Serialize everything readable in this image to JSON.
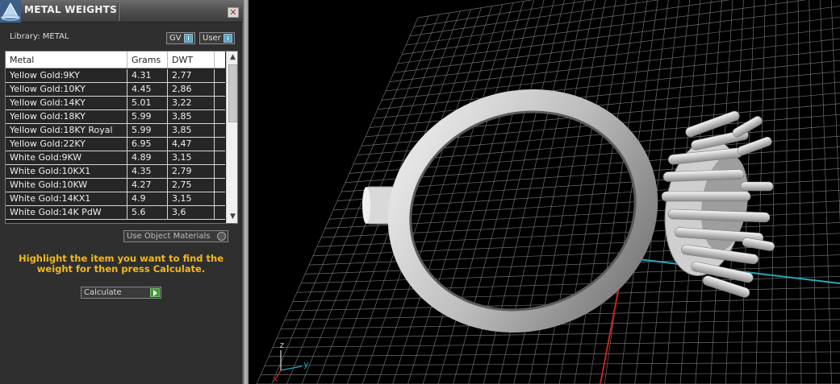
{
  "panel": {
    "title": "METAL WEIGHTS",
    "close_glyph": "✕",
    "library_label": "Library: METAL",
    "gv_label": "GV",
    "user_label": "User",
    "columns": [
      "Metal",
      "Grams",
      "DWT"
    ],
    "rows": [
      {
        "metal": "Yellow Gold:9KY",
        "grams": "4.31",
        "dwt": "2,77"
      },
      {
        "metal": "Yellow Gold:10KY",
        "grams": "4.45",
        "dwt": "2,86"
      },
      {
        "metal": "Yellow Gold:14KY",
        "grams": "5.01",
        "dwt": "3,22"
      },
      {
        "metal": "Yellow Gold:18KY",
        "grams": "5.99",
        "dwt": "3,85"
      },
      {
        "metal": "Yellow Gold:18KY Royal",
        "grams": "5.99",
        "dwt": "3,85"
      },
      {
        "metal": "Yellow Gold:22KY",
        "grams": "6.95",
        "dwt": "4,47"
      },
      {
        "metal": "White Gold:9KW",
        "grams": "4.89",
        "dwt": "3,15"
      },
      {
        "metal": "White Gold:10KX1",
        "grams": "4.35",
        "dwt": "2,79"
      },
      {
        "metal": "White Gold:10KW",
        "grams": "4.27",
        "dwt": "2,75"
      },
      {
        "metal": "White Gold:14KX1",
        "grams": "4.9",
        "dwt": "3,15"
      },
      {
        "metal": "White Gold:14K PdW",
        "grams": "5.6",
        "dwt": "3,6"
      }
    ],
    "use_object_materials_label": "Use Object Materials",
    "instructions": "Highlight the item you want to find the weight for then press Calculate.",
    "calculate_label": "Calculate"
  },
  "viewport": {
    "axis_labels": {
      "z": "z",
      "y": "y",
      "x": "x"
    },
    "colors": {
      "x_axis": "#c0271e",
      "y_axis": "#2aa6bf",
      "z_axis": "#c8c8c8",
      "grid": "#6e6e6e"
    }
  },
  "icons": {
    "app_logo": "app-logo-icon",
    "close": "close-icon",
    "toggle": "toggle-icon",
    "go": "play-arrow-icon"
  }
}
